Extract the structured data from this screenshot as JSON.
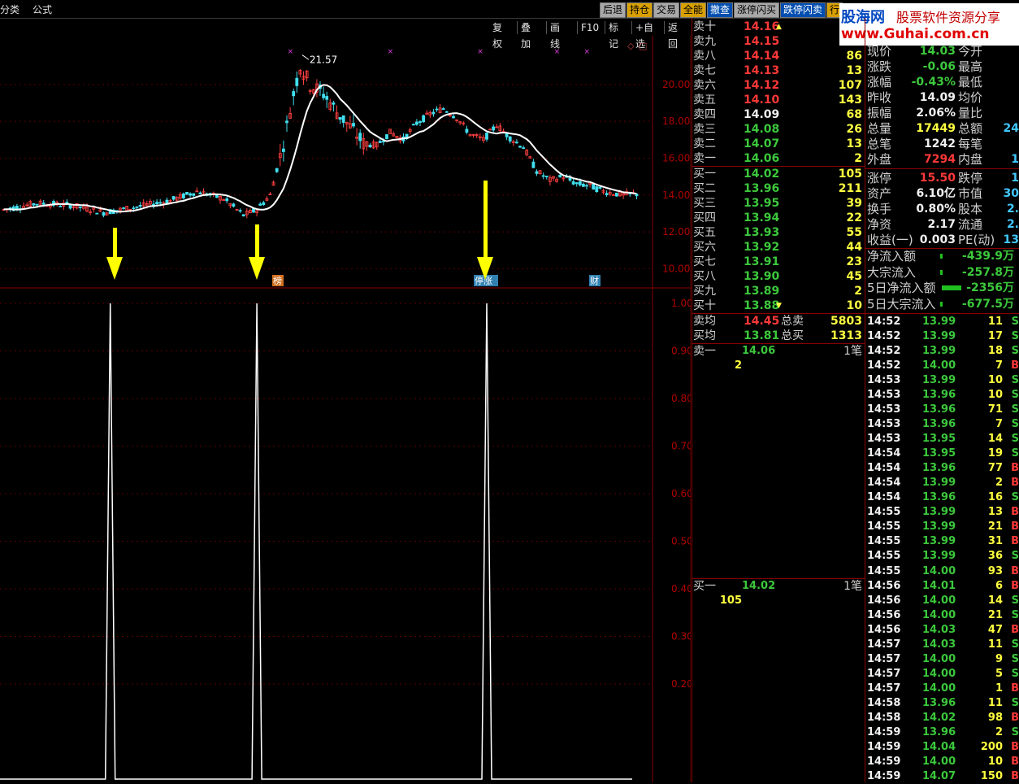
{
  "menu": {
    "classify": "分类",
    "formula": "公式"
  },
  "toolbar": [
    {
      "label": "后退",
      "style": "g"
    },
    {
      "label": "持仓",
      "style": "o"
    },
    {
      "label": "交易",
      "style": "g"
    },
    {
      "label": "全能",
      "style": "o"
    },
    {
      "label": "撤查",
      "style": "b"
    },
    {
      "label": "涨停闪买",
      "style": "g"
    },
    {
      "label": "跌停闪卖",
      "style": "b"
    },
    {
      "label": "行",
      "style": "o"
    }
  ],
  "chart_tools": [
    "复权",
    "叠加",
    "画线",
    "F10",
    "标记",
    "+自选",
    "返回"
  ],
  "logo": {
    "name": "股海网",
    "slogan": "股票软件资源分享",
    "url": "www.Guhai.com.cn"
  },
  "chart_data": [
    {
      "type": "candlestick",
      "title": "",
      "y_ticks": [
        "20.00",
        "18.00",
        "16.00",
        "14.00",
        "12.00",
        "10.00"
      ],
      "ylim": [
        9.4,
        22.2
      ],
      "max_label": "21.57",
      "markers": [
        {
          "label": "榜",
          "color": "#d07020"
        },
        {
          "label": "停涨",
          "color": "#3080b0"
        },
        {
          "label": "财",
          "color": "#3080b0"
        }
      ]
    },
    {
      "type": "line",
      "title": "",
      "y_ticks": [
        "1.00",
        "0.90",
        "0.80",
        "0.70",
        "0.60",
        "0.50",
        "0.40",
        "0.30",
        "0.20"
      ],
      "ylim": [
        0,
        1.0
      ],
      "spikes_at_candle_index": [
        32,
        76,
        145
      ]
    }
  ],
  "quote": {
    "sell": [
      {
        "label": "卖十",
        "price": "14.16",
        "vol": "",
        "mark": "▲"
      },
      {
        "label": "卖九",
        "price": "14.15",
        "vol": ""
      },
      {
        "label": "卖八",
        "price": "14.14",
        "vol": "86"
      },
      {
        "label": "卖七",
        "price": "14.13",
        "vol": "13"
      },
      {
        "label": "卖六",
        "price": "14.12",
        "vol": "107"
      },
      {
        "label": "卖五",
        "price": "14.10",
        "vol": "143"
      },
      {
        "label": "卖四",
        "price": "14.09",
        "vol": "68"
      },
      {
        "label": "卖三",
        "price": "14.08",
        "vol": "26"
      },
      {
        "label": "卖二",
        "price": "14.07",
        "vol": "13"
      },
      {
        "label": "卖一",
        "price": "14.06",
        "vol": "2"
      }
    ],
    "buy": [
      {
        "label": "买一",
        "price": "14.02",
        "vol": "105"
      },
      {
        "label": "买二",
        "price": "13.96",
        "vol": "211"
      },
      {
        "label": "买三",
        "price": "13.95",
        "vol": "39"
      },
      {
        "label": "买四",
        "price": "13.94",
        "vol": "22"
      },
      {
        "label": "买五",
        "price": "13.93",
        "vol": "55"
      },
      {
        "label": "买六",
        "price": "13.92",
        "vol": "44"
      },
      {
        "label": "买七",
        "price": "13.91",
        "vol": "23"
      },
      {
        "label": "买八",
        "price": "13.90",
        "vol": "45"
      },
      {
        "label": "买九",
        "price": "13.89",
        "vol": "2"
      },
      {
        "label": "买十",
        "price": "13.88",
        "vol": "10",
        "mark": "▼"
      }
    ],
    "avg_sell": {
      "label": "卖均",
      "price": "14.45",
      "tlabel": "总卖",
      "total": "5803"
    },
    "avg_buy": {
      "label": "买均",
      "price": "13.81",
      "tlabel": "总买",
      "total": "1313"
    },
    "queue_sell": {
      "label": "卖一",
      "price": "14.06",
      "cnt": "1笔",
      "vol": "2"
    },
    "queue_buy": {
      "label": "买一",
      "price": "14.02",
      "cnt": "1笔",
      "vol": "105"
    }
  },
  "stats": [
    {
      "l1": "现价",
      "v1": "14.03",
      "c1": "grn",
      "l2": "今开",
      "v2": ""
    },
    {
      "l1": "涨跌",
      "v1": "-0.06",
      "c1": "grn",
      "l2": "最高",
      "v2": ""
    },
    {
      "l1": "涨幅",
      "v1": "-0.43%",
      "c1": "grn",
      "l2": "最低",
      "v2": ""
    },
    {
      "l1": "昨收",
      "v1": "14.09",
      "c1": "wht",
      "l2": "均价",
      "v2": ""
    },
    {
      "l1": "振幅",
      "v1": "2.06%",
      "c1": "wht",
      "l2": "量比",
      "v2": ""
    },
    {
      "l1": "总量",
      "v1": "17449",
      "c1": "yel",
      "l2": "总额",
      "v2": "24"
    },
    {
      "l1": "总笔",
      "v1": "1242",
      "c1": "wht",
      "l2": "每笔",
      "v2": ""
    },
    {
      "l1": "外盘",
      "v1": "7294",
      "c1": "red",
      "l2": "内盘",
      "v2": "1"
    },
    {
      "l1": "涨停",
      "v1": "15.50",
      "c1": "red",
      "l2": "跌停",
      "v2": "1"
    },
    {
      "l1": "资产",
      "v1": "6.10亿",
      "c1": "wht",
      "l2": "市值",
      "v2": "30"
    },
    {
      "l1": "换手",
      "v1": "0.80%",
      "c1": "wht",
      "l2": "股本",
      "v2": "2."
    },
    {
      "l1": "净资",
      "v1": "2.17",
      "c1": "wht",
      "l2": "流通",
      "v2": "2."
    },
    {
      "l1": "收益(一)",
      "v1": "0.003",
      "c1": "wht",
      "l2": "PE(动)",
      "v2": "13"
    }
  ],
  "flows": [
    {
      "label": "净流入额",
      "value": "-439.9万"
    },
    {
      "label": "大宗流入",
      "value": "-257.8万"
    },
    {
      "label": "5日净流入额",
      "value": "-2356万"
    },
    {
      "label": "5日大宗流入",
      "value": "-677.5万"
    }
  ],
  "ticks": [
    {
      "t": "14:52",
      "p": "13.99",
      "v": "11",
      "s": "S"
    },
    {
      "t": "14:52",
      "p": "13.99",
      "v": "17",
      "s": "S"
    },
    {
      "t": "14:52",
      "p": "13.99",
      "v": "18",
      "s": "S"
    },
    {
      "t": "14:52",
      "p": "14.00",
      "v": "7",
      "s": "B"
    },
    {
      "t": "14:53",
      "p": "13.99",
      "v": "10",
      "s": "S"
    },
    {
      "t": "14:53",
      "p": "13.96",
      "v": "10",
      "s": "S"
    },
    {
      "t": "14:53",
      "p": "13.96",
      "v": "71",
      "s": "S"
    },
    {
      "t": "14:53",
      "p": "13.96",
      "v": "7",
      "s": "S"
    },
    {
      "t": "14:53",
      "p": "13.95",
      "v": "14",
      "s": "S"
    },
    {
      "t": "14:54",
      "p": "13.95",
      "v": "19",
      "s": "S"
    },
    {
      "t": "14:54",
      "p": "13.96",
      "v": "77",
      "s": "B"
    },
    {
      "t": "14:54",
      "p": "13.99",
      "v": "2",
      "s": "B"
    },
    {
      "t": "14:54",
      "p": "13.96",
      "v": "16",
      "s": "S"
    },
    {
      "t": "14:55",
      "p": "13.99",
      "v": "13",
      "s": "B"
    },
    {
      "t": "14:55",
      "p": "13.99",
      "v": "21",
      "s": "B"
    },
    {
      "t": "14:55",
      "p": "13.99",
      "v": "31",
      "s": "B"
    },
    {
      "t": "14:55",
      "p": "13.99",
      "v": "36",
      "s": "S"
    },
    {
      "t": "14:55",
      "p": "14.00",
      "v": "93",
      "s": "B"
    },
    {
      "t": "14:56",
      "p": "14.01",
      "v": "6",
      "s": "B"
    },
    {
      "t": "14:56",
      "p": "14.00",
      "v": "14",
      "s": "S"
    },
    {
      "t": "14:56",
      "p": "14.00",
      "v": "21",
      "s": "S"
    },
    {
      "t": "14:56",
      "p": "14.03",
      "v": "47",
      "s": "B"
    },
    {
      "t": "14:57",
      "p": "14.03",
      "v": "11",
      "s": "S"
    },
    {
      "t": "14:57",
      "p": "14.00",
      "v": "9",
      "s": "S"
    },
    {
      "t": "14:57",
      "p": "14.00",
      "v": "5",
      "s": "S"
    },
    {
      "t": "14:57",
      "p": "14.00",
      "v": "1",
      "s": "B"
    },
    {
      "t": "14:58",
      "p": "13.96",
      "v": "11",
      "s": "S"
    },
    {
      "t": "14:58",
      "p": "14.02",
      "v": "98",
      "s": "B"
    },
    {
      "t": "14:59",
      "p": "13.96",
      "v": "2",
      "s": "S"
    },
    {
      "t": "14:59",
      "p": "14.04",
      "v": "200",
      "s": "B"
    },
    {
      "t": "14:59",
      "p": "14.00",
      "v": "10",
      "s": "B"
    },
    {
      "t": "14:59",
      "p": "14.07",
      "v": "150",
      "s": "B"
    }
  ]
}
